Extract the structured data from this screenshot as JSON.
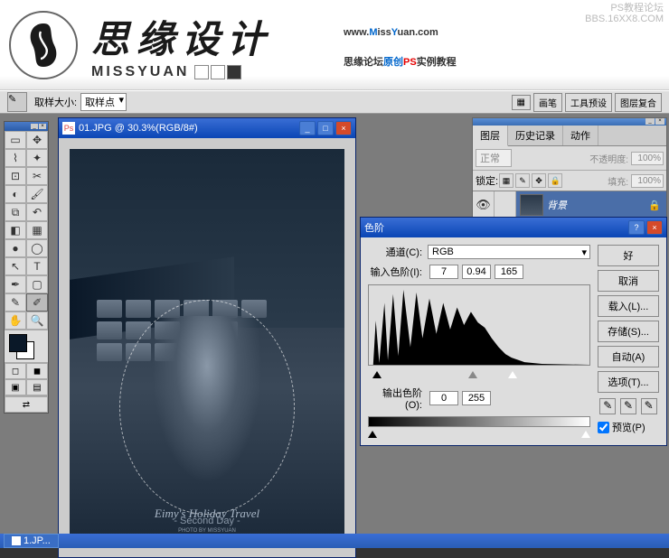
{
  "banner": {
    "brand_cn": "思缘设计",
    "brand_en": "MISSYUAN",
    "url_pre": "www.",
    "url_m": "M",
    "url_iss": "iss",
    "url_y": "Y",
    "url_uan": "uan.com",
    "tagline_a": "思缘论坛",
    "tagline_b": "原创",
    "tagline_c": "PS",
    "tagline_d": "实例教程",
    "watermark1": "PS教程论坛",
    "watermark2": "BBS.16XX8.COM"
  },
  "options": {
    "sample_label": "取样大小:",
    "sample_value": "取样点",
    "btn1": "画笔",
    "btn2": "工具预设",
    "btn3": "图层复合"
  },
  "doc": {
    "title": "01.JPG @ 30.3%(RGB/8#)",
    "poster_title": "Eimy's Holiday Travel",
    "poster_sub": "- Second Day -",
    "poster_credit": "PHOTO BY MISSYUAN"
  },
  "levels": {
    "title": "色阶",
    "channel_label": "通道(C):",
    "channel_value": "RGB",
    "input_label": "输入色阶(I):",
    "in_black": "7",
    "in_gamma": "0.94",
    "in_white": "165",
    "output_label": "输出色阶(O):",
    "out_black": "0",
    "out_white": "255",
    "btn_ok": "好",
    "btn_cancel": "取消",
    "btn_load": "载入(L)...",
    "btn_save": "存储(S)...",
    "btn_auto": "自动(A)",
    "btn_options": "选项(T)...",
    "preview": "预览(P)"
  },
  "layers": {
    "tab1": "图层",
    "tab2": "历史记录",
    "tab3": "动作",
    "mode": "正常",
    "opacity_label": "不透明度:",
    "opacity": "100%",
    "lock_label": "锁定:",
    "fill_label": "填充:",
    "fill": "100%",
    "layer_name": "背景"
  },
  "taskbar": {
    "item1": "1.JP..."
  },
  "chart_data": {
    "type": "histogram",
    "title": "色阶",
    "channel": "RGB",
    "input_range": [
      7,
      165
    ],
    "gamma": 0.94,
    "output_range": [
      0,
      255
    ],
    "xlim": [
      0,
      255
    ],
    "notes": "Image tonal distribution concentrated in shadows/midtones (~10–170) with multiple spikes; highlights sparse."
  }
}
